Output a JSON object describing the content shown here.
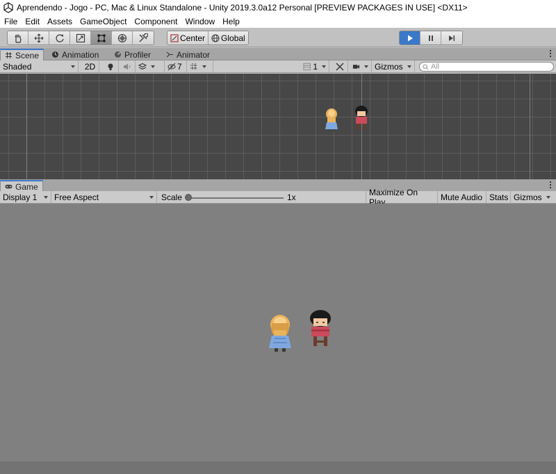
{
  "window": {
    "title": "Aprendendo - Jogo - PC, Mac & Linux Standalone - Unity 2019.3.0a12 Personal [PREVIEW PACKAGES IN USE] <DX11>"
  },
  "menu": [
    "File",
    "Edit",
    "Assets",
    "GameObject",
    "Component",
    "Window",
    "Help"
  ],
  "toolbar": {
    "tools": [
      "hand-tool",
      "move-tool",
      "rotate-tool",
      "scale-tool",
      "rect-tool",
      "transform-tool",
      "custom-editor-tool"
    ],
    "active_tool": "rect-tool",
    "pivot_mode": "Center",
    "pivot_rotation": "Global",
    "play_active": true
  },
  "scene_panel": {
    "tabs": [
      "Scene",
      "Animation",
      "Profiler",
      "Animator"
    ],
    "active_tab": "Scene",
    "controls": {
      "shading_mode": "Shaded",
      "mode_2d": "2D",
      "hidden_count": "7",
      "layers_count": "1",
      "gizmos": "Gizmos",
      "search_placeholder": "All"
    }
  },
  "game_panel": {
    "tab": "Game",
    "controls": {
      "display": "Display 1",
      "aspect": "Free Aspect",
      "scale_label": "Scale",
      "scale_value": "1x",
      "maximize": "Maximize On Play",
      "mute": "Mute Audio",
      "stats": "Stats",
      "gizmos": "Gizmos"
    }
  },
  "colors": {
    "play_accent": "#3a78c9",
    "scene_bg": "#474747",
    "game_bg": "#808080",
    "girl_hair": "#e9b45c",
    "girl_dress": "#7fa8e0",
    "boy_hair": "#1a1a1a",
    "boy_shirt": "#cc4a5a"
  }
}
